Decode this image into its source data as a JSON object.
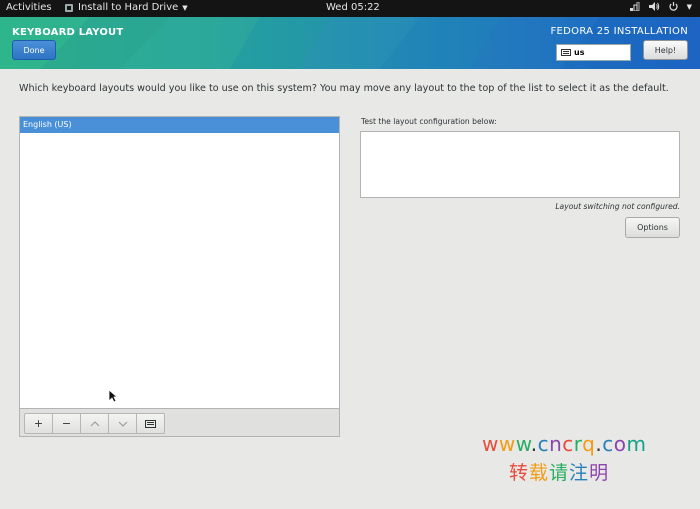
{
  "topbar": {
    "activities": "Activities",
    "app_name": "Install to Hard Drive",
    "clock": "Wed 05:22"
  },
  "header": {
    "spoke_title": "KEYBOARD LAYOUT",
    "done_label": "Done",
    "product_title": "FEDORA 25 INSTALLATION",
    "layout_indicator": "us",
    "help_label": "Help!"
  },
  "main": {
    "description": "Which keyboard layouts would you like to use on this system?  You may move any layout to the top of the list to select it as the default.",
    "layouts": [
      "English (US)"
    ],
    "test_label": "Test the layout configuration below:",
    "test_value": "",
    "switching_note": "Layout switching not configured.",
    "options_label": "Options"
  },
  "toolbar": {
    "add": "+",
    "remove": "−",
    "up": "︿",
    "down": "﹀"
  },
  "watermark": {
    "url_letters": [
      "w",
      "w",
      "w",
      ".",
      "c",
      "n",
      "c",
      "r",
      "q",
      ".",
      "c",
      "o",
      "m"
    ],
    "url_colors": [
      "#e84c3d",
      "#f39c12",
      "#27ae60",
      "#2e3436",
      "#2980b9",
      "#8e44ad",
      "#e84c3d",
      "#27ae60",
      "#f39c12",
      "#2e3436",
      "#2980b9",
      "#8e44ad",
      "#16a085"
    ],
    "cn_chars": [
      "转",
      "载",
      "请",
      "注",
      "明"
    ],
    "cn_colors": [
      "#e84c3d",
      "#f39c12",
      "#27ae60",
      "#2980b9",
      "#8e44ad"
    ]
  },
  "colors": {
    "header_start": "#2bb08a",
    "header_end": "#1f66c6",
    "selection": "#4a90d9",
    "done_button": "#2f74c4"
  }
}
